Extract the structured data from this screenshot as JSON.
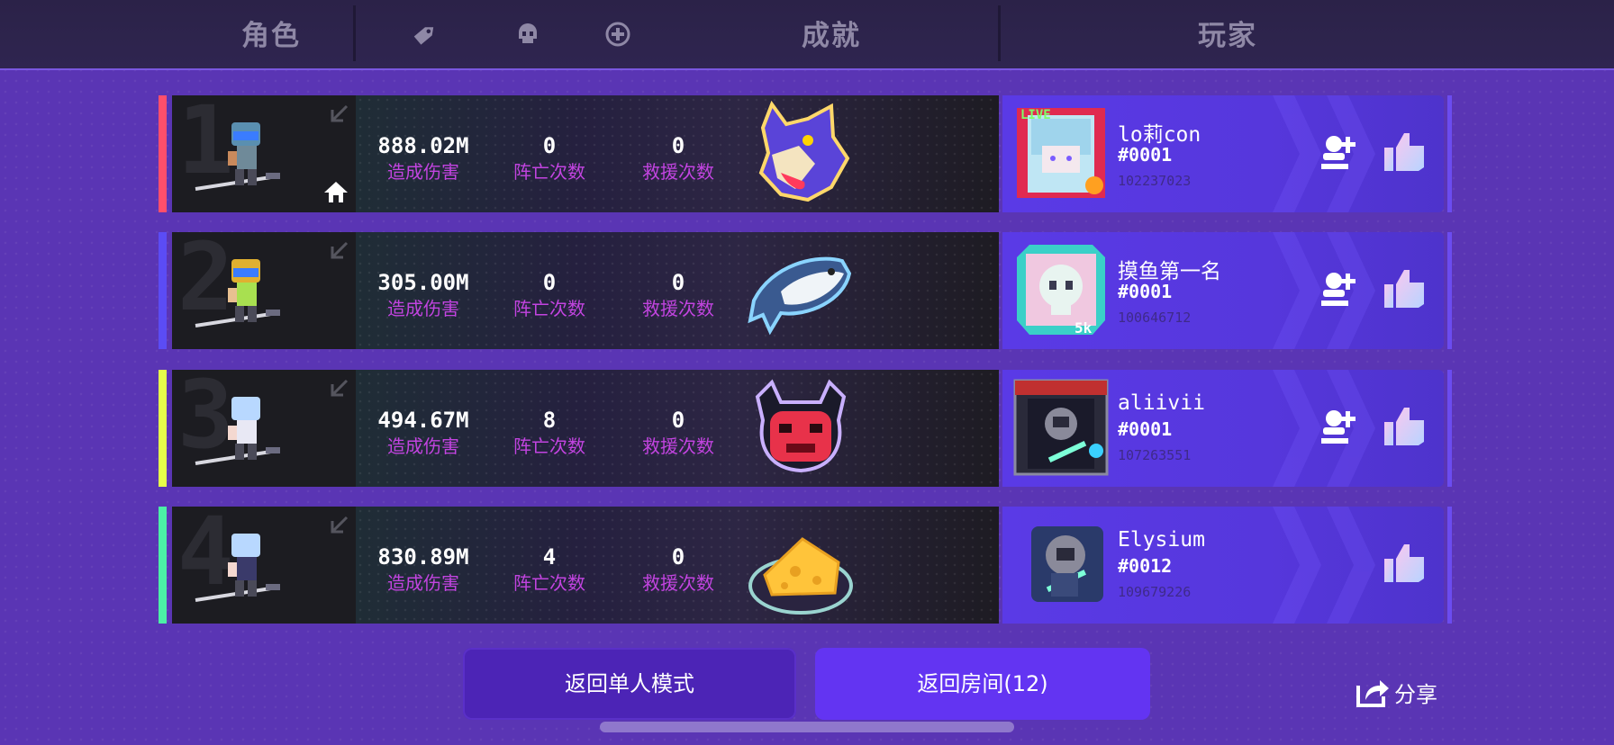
{
  "header": {
    "role": "角色",
    "achievement": "成就",
    "player": "玩家",
    "filter_icons": [
      "tag-icon",
      "skull-icon",
      "plus-circle-icon"
    ]
  },
  "stat_labels": {
    "damage": "造成伤害",
    "deaths": "阵亡次数",
    "rescues": "救援次数"
  },
  "rows": [
    {
      "rank": "1",
      "stripe_color": "#ff4f6b",
      "damage": "888.02M",
      "deaths": "0",
      "rescues": "0",
      "achievement_icon": "wolf-head-icon",
      "player_name": "lo莉con",
      "player_tag": "#0001",
      "player_id": "102237023",
      "has_home": true,
      "has_add_friend": true
    },
    {
      "rank": "2",
      "stripe_color": "#5b4cf5",
      "damage": "305.00M",
      "deaths": "0",
      "rescues": "0",
      "achievement_icon": "fish-icon",
      "player_name": "摸鱼第一名",
      "player_tag": "#0001",
      "player_id": "100646712",
      "has_home": false,
      "has_add_friend": true
    },
    {
      "rank": "3",
      "stripe_color": "#e6ff4a",
      "damage": "494.67M",
      "deaths": "8",
      "rescues": "0",
      "achievement_icon": "demon-face-icon",
      "player_name": "aliivii",
      "player_tag": "#0001",
      "player_id": "107263551",
      "has_home": false,
      "has_add_friend": true
    },
    {
      "rank": "4",
      "stripe_color": "#4cf0a6",
      "damage": "830.89M",
      "deaths": "4",
      "rescues": "0",
      "achievement_icon": "cheese-icon",
      "player_name": "Elysium",
      "player_tag": "#0012",
      "player_id": "109679226",
      "has_home": false,
      "has_add_friend": false
    }
  ],
  "buttons": {
    "back_single": "返回单人模式",
    "back_room": "返回房间(12)",
    "share": "分享"
  }
}
